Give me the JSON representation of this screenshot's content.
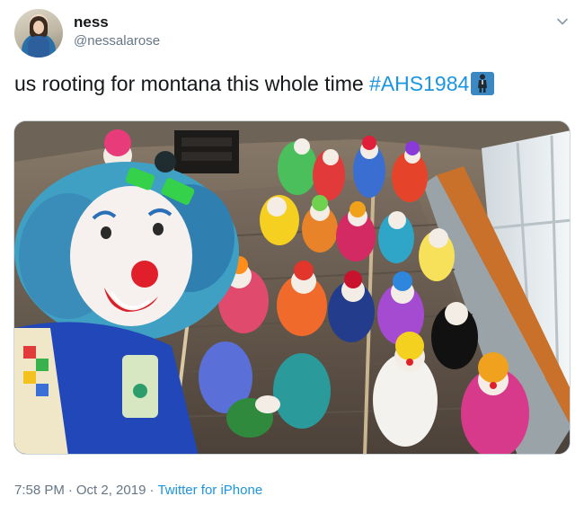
{
  "user": {
    "display_name": "ness",
    "handle": "@nessalarose"
  },
  "tweet": {
    "text": "us rooting for montana this whole time ",
    "hashtag": "#AHS1984",
    "emoji_name": "man-in-business-suit-levitating-emoji"
  },
  "media": {
    "description_icon": "photo-of-clowns-on-staircase"
  },
  "meta": {
    "time": "7:58 PM",
    "separator": "·",
    "date": "Oct 2, 2019",
    "source": "Twitter for iPhone"
  },
  "colors": {
    "link": "#1b95e0",
    "secondary_text": "#657786",
    "primary_text": "#14171a",
    "border": "#ccd6dd"
  }
}
